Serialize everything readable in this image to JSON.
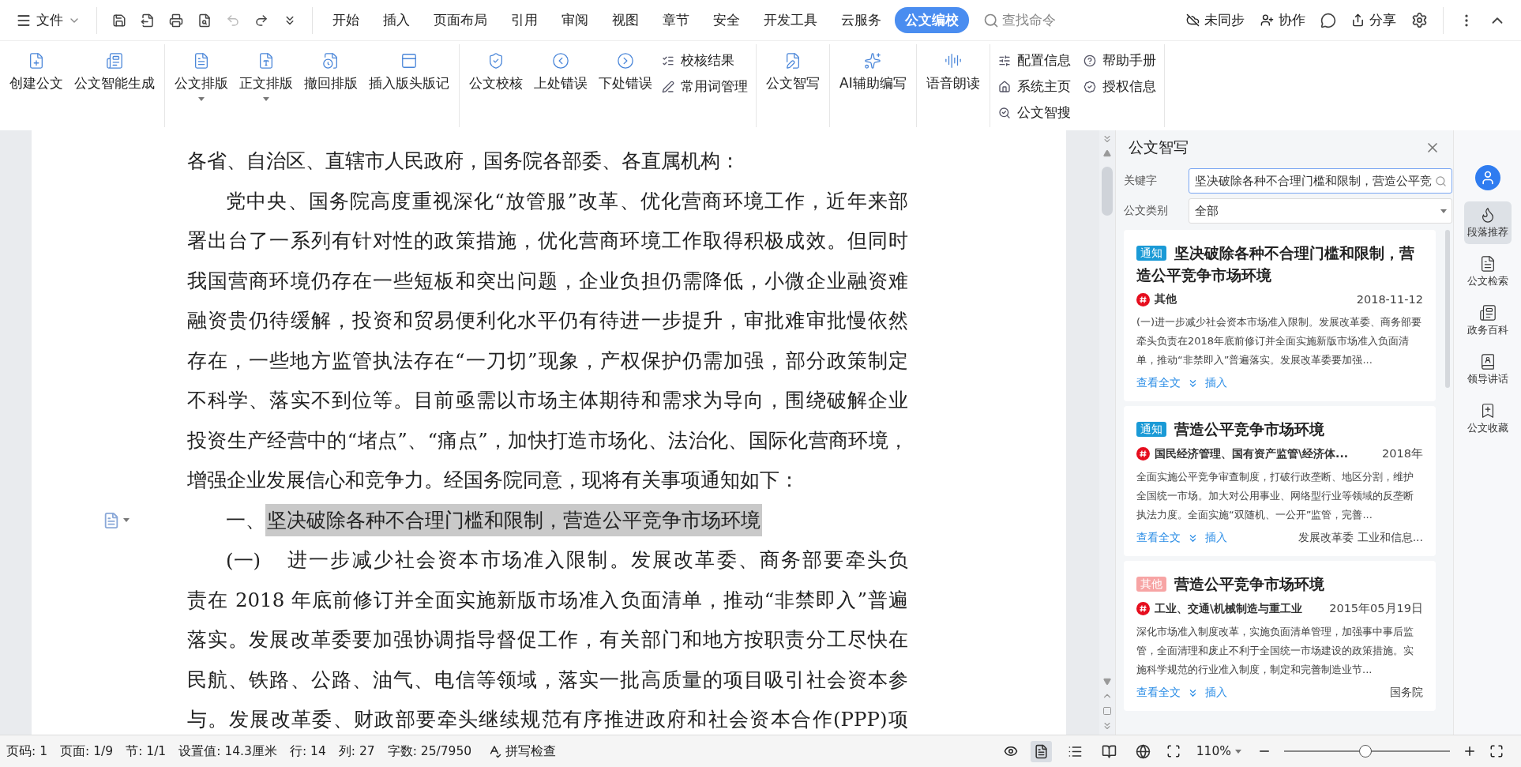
{
  "menu_bar": {
    "file_menu": "文件",
    "tabs": [
      {
        "label": "开始",
        "selected": false
      },
      {
        "label": "插入",
        "selected": false
      },
      {
        "label": "页面布局",
        "selected": false
      },
      {
        "label": "引用",
        "selected": false
      },
      {
        "label": "审阅",
        "selected": false
      },
      {
        "label": "视图",
        "selected": false
      },
      {
        "label": "章节",
        "selected": false
      },
      {
        "label": "安全",
        "selected": false
      },
      {
        "label": "开发工具",
        "selected": false
      },
      {
        "label": "云服务",
        "selected": false
      },
      {
        "label": "公文编校",
        "selected": true
      }
    ],
    "search_placeholder": "查找命令",
    "sync": "未同步",
    "collab": "协作",
    "share": "分享"
  },
  "ribbon": {
    "groups": [
      {
        "large": [
          {
            "label": "创建公文",
            "dropdown": false
          },
          {
            "label": "公文智能生成",
            "dropdown": false
          }
        ]
      },
      {
        "large": [
          {
            "label": "公文排版",
            "dropdown": true
          },
          {
            "label": "正文排版",
            "dropdown": true
          },
          {
            "label": "撤回排版",
            "dropdown": false
          },
          {
            "label": "插入版头版记",
            "dropdown": false
          }
        ]
      },
      {
        "large": [
          {
            "label": "公文校核",
            "dropdown": false
          },
          {
            "label": "上处错误",
            "dropdown": false
          },
          {
            "label": "下处错误",
            "dropdown": false
          }
        ],
        "small": [
          "校核结果",
          "常用词管理"
        ]
      },
      {
        "large": [
          {
            "label": "公文智写",
            "dropdown": false
          }
        ]
      },
      {
        "large": [
          {
            "label": "AI辅助编写",
            "dropdown": false
          }
        ]
      },
      {
        "large": [
          {
            "label": "语音朗读",
            "dropdown": false
          }
        ]
      },
      {
        "small": [
          "配置信息",
          "帮助手册",
          "系统主页",
          "授权信息",
          "公文智搜"
        ]
      }
    ]
  },
  "document": {
    "salutation": "各省、自治区、直辖市人民政府，国务院各部委、各直属机构：",
    "paragraph_1": [
      "党中央、国务院高度重视深化“放管服”改革、优化营商环境工作，近年来部",
      "署出台了一系列有针对性的政策措施，优化营商环境工作取得积极成效。但同时",
      "我国营商环境仍存在一些短板和突出问题，企业负担仍需降低，小微企业融资难",
      "融资贵仍待缓解，投资和贸易便利化水平仍有待进一步提升，审批难审批慢依然",
      "存在，一些地方监管执法存在“一刀切”现象，产权保护仍需加强，部分政策制定",
      "不科学、落实不到位等。目前亟需以市场主体期待和需求为导向，围绕破解企业",
      "投资生产经营中的“堵点”、“痛点”，加快打造市场化、法治化、国际化营商环境，",
      "增强企业发展信心和竞争力。经国务院同意，现将有关事项通知如下："
    ],
    "heading": {
      "number": "一、",
      "text": "坚决破除各种不合理门槛和限制，营造公平竞争市场环境",
      "selected": true
    },
    "paragraph_2": {
      "number": "(一)",
      "lines": [
        "进一步减少社会资本市场准入限制。发展改革委、商务部要牵头负",
        "责在 2018 年底前修订并全面实施新版市场准入负面清单，推动“非禁即入”普遍",
        "落实。发展改革委要加强协调指导督促工作，有关部门和地方按职责分工尽快在",
        "民航、铁路、公路、油气、电信等领域，落实一批高质量的项目吸引社会资本参",
        "与。发展改革委、财政部要牵头继续规范有序推进政府和社会资本合作(PPP)项"
      ]
    }
  },
  "panel": {
    "title": "公文智写",
    "keyword": {
      "label": "关键字",
      "value": "坚决破除各种不合理门槛和限制，营造公平竞"
    },
    "category": {
      "label": "公文类别",
      "value": "全部"
    },
    "results": [
      {
        "tag": {
          "label": "通知",
          "color": "#1a9ad6"
        },
        "title": "坚决破除各种不合理门槛和限制，营造公平竞争市场环境",
        "category": "其他",
        "date": "2018-11-12",
        "excerpt": "(一)进一步减少社会资本市场准入限制。发展改革委、商务部要牵头负责在2018年底前修订并全面实施新版市场准入负面清单，推动“非禁即入”普遍落实。发展改革委要加强...",
        "view": "查看全文",
        "insert": "插入"
      },
      {
        "tag": {
          "label": "通知",
          "color": "#1a9ad6"
        },
        "title": "营造公平竞争市场环境",
        "category": "国民经济管理、国有资产监管\\经济体...",
        "date": "2018年",
        "excerpt": "全面实施公平竞争审查制度，打破行政垄断、地区分割，维护全国统一市场。加大对公用事业、网络型行业等领域的反垄断执法力度。全面实施“双随机、一公开”监管，完善...",
        "view": "查看全文",
        "insert": "插入",
        "source": "发展改革委 工业和信息..."
      },
      {
        "tag": {
          "label": "其他",
          "color": "#f7a4a4"
        },
        "title": "营造公平竞争市场环境",
        "category": "工业、交通\\机械制造与重工业",
        "date": "2015年05月19日",
        "excerpt": " 深化市场准入制度改革，实施负面清单管理，加强事中事后监管，全面清理和废止不利于全国统一市场建设的政策措施。实施科学规范的行业准入制度，制定和完善制造业节...",
        "view": "查看全文",
        "insert": "插入",
        "source": "国务院"
      }
    ]
  },
  "side_nav": [
    {
      "label": "段落推荐",
      "selected": true
    },
    {
      "label": "公文检索",
      "selected": false
    },
    {
      "label": "政务百科",
      "selected": false
    },
    {
      "label": "领导讲话",
      "selected": false
    },
    {
      "label": "公文收藏",
      "selected": false
    }
  ],
  "status_bar": {
    "items": [
      "页码: 1",
      "页面: 1/9",
      "节: 1/1",
      "设置值: 14.3厘米",
      "行: 14",
      "列: 27",
      "字数: 25/7950"
    ],
    "spell_check": "拼写检查",
    "view_modes": [
      {
        "selected": true
      },
      {
        "selected": false
      },
      {
        "selected": false
      },
      {
        "selected": false
      }
    ],
    "zoom": "110%",
    "zoom_slider": {
      "level": 0.49
    }
  }
}
